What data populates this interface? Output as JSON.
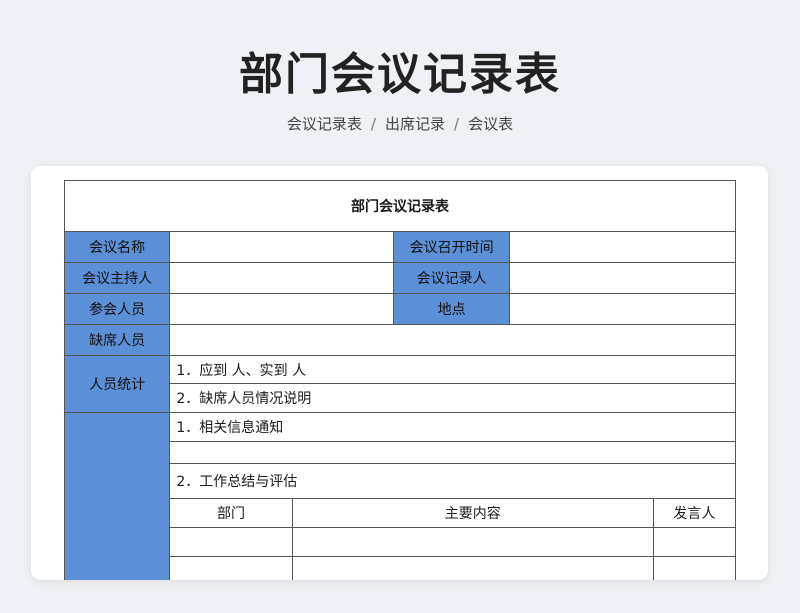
{
  "header": {
    "title": "部门会议记录表",
    "breadcrumb": [
      "会议记录表",
      "出席记录",
      "会议表"
    ],
    "separator": "/"
  },
  "form": {
    "title": "部门会议记录表",
    "labels": {
      "meeting_name": "会议名称",
      "meeting_time": "会议召开时间",
      "host": "会议主持人",
      "recorder": "会议记录人",
      "attendees": "参会人员",
      "location": "地点",
      "absentees": "缺席人员",
      "stats": "人员统计"
    },
    "values": {
      "meeting_name": "",
      "meeting_time": "",
      "host": "",
      "recorder": "",
      "attendees": "",
      "location": "",
      "absentees": ""
    },
    "stats_lines": [
      "1．应到  人、实到  人",
      "2．缺席人员情况说明"
    ],
    "content_lines": [
      "1．相关信息通知",
      "2．工作总结与评估"
    ],
    "speech_table": {
      "headers": [
        "部门",
        "主要内容",
        "发言人"
      ],
      "rows": [
        [
          "",
          "",
          ""
        ],
        [
          "",
          "",
          ""
        ]
      ]
    }
  },
  "colors": {
    "label_bg": "#5b8fd6",
    "page_bg": "#eef1f5"
  }
}
